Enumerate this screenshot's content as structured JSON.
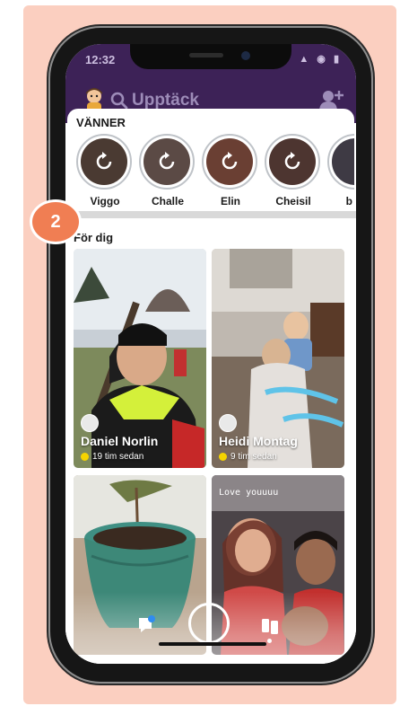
{
  "status_bar": {
    "time": "12:32",
    "signal": "▲ ◉ ▮"
  },
  "topbar": {
    "search_label": "Upptäck"
  },
  "friends": {
    "title": "VÄNNER",
    "items": [
      {
        "name": "Viggo"
      },
      {
        "name": "Challe"
      },
      {
        "name": "Elin"
      },
      {
        "name": "Cheisil"
      },
      {
        "name": "b"
      }
    ]
  },
  "for_you": {
    "title": "För dig",
    "tiles": [
      {
        "name": "Daniel Norlin",
        "time": "19 tim sedan"
      },
      {
        "name": "Heidi Montag",
        "time": "9 tim sedan"
      },
      {
        "caption": ""
      },
      {
        "caption": "Love youuuu"
      }
    ]
  },
  "step_badge": "2",
  "colors": {
    "header": "#3d2257",
    "badge": "#f07e53",
    "panel": "#fbcfc0",
    "story_dot": "#f5d400"
  }
}
